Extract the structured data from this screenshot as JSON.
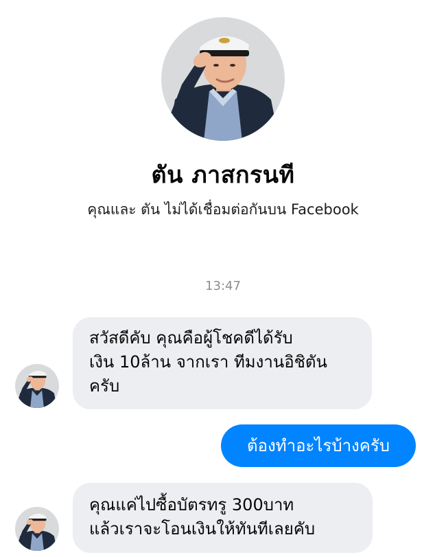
{
  "contact": {
    "name": "ตัน ภาสกรนที",
    "subtitle": "คุณและ ตัน ไม่ได้เชื่อมต่อกันบน Facebook",
    "avatar_icon": "captain-salute-portrait"
  },
  "conversation": {
    "timestamp": "13:47",
    "messages": [
      {
        "sender": "contact",
        "text": "สวัสดีคับ คุณคือผู้โชคดีได้รับ\nเงิน 10ล้าน จากเรา ทีมงานอิชิตัน\nครับ"
      },
      {
        "sender": "me",
        "text": "ต้องทำอะไรบ้างครับ"
      },
      {
        "sender": "contact",
        "text": "คุณแค่ไปซื้อบัตรทรู 300บาท\nแล้วเราจะโอนเงินให้ทันทีเลยคับ"
      }
    ]
  },
  "colors": {
    "outgoing_bubble": "#0084ff",
    "incoming_bubble": "#eceef1",
    "timestamp": "#8a8d91"
  }
}
